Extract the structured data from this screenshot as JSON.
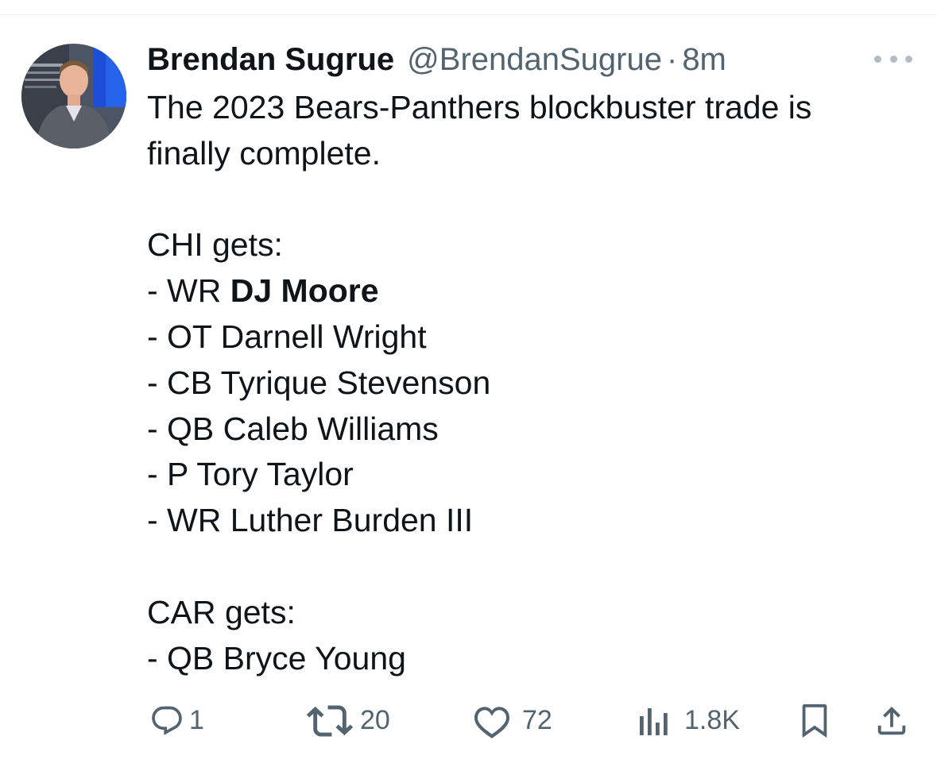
{
  "tweet": {
    "author": {
      "display_name": "Brendan Sugrue",
      "handle": "@BrendanSugrue",
      "separator": "·",
      "time": "8m"
    },
    "lines": [
      "The 2023 Bears-Panthers blockbuster trade is",
      "finally complete.",
      "",
      "CHI gets:",
      "- WR ",
      "- OT Darnell Wright",
      "- CB Tyrique Stevenson",
      "- QB Caleb Williams",
      "- P Tory Taylor",
      "- WR Luther Burden III",
      "",
      "CAR gets:",
      "- QB Bryce Young"
    ],
    "bold_name": "DJ Moore",
    "actions": {
      "reply_count": "1",
      "retweet_count": "20",
      "like_count": "72",
      "views_count": "1.8K"
    },
    "icons": [
      "more-icon",
      "reply-icon",
      "retweet-icon",
      "like-icon",
      "views-icon",
      "bookmark-icon",
      "share-icon"
    ],
    "colors": {
      "text": "#0f1419",
      "secondary": "#536471",
      "divider": "#eff3f4"
    }
  }
}
